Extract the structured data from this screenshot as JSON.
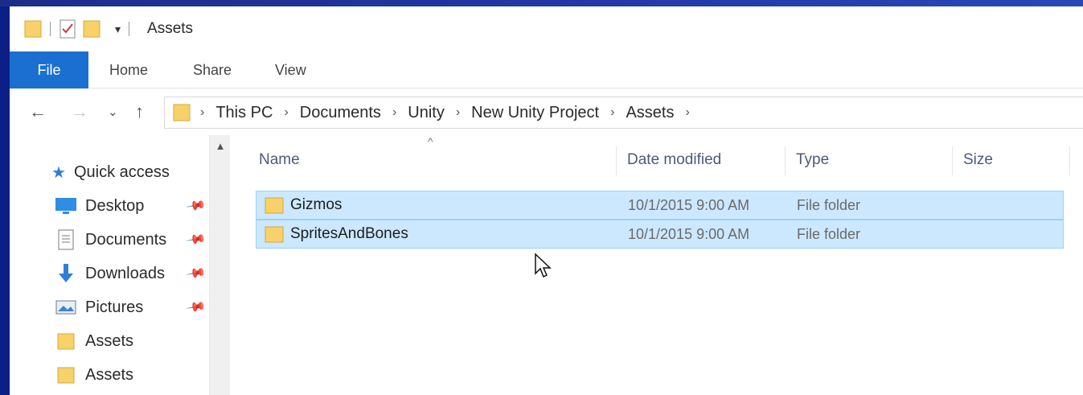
{
  "window": {
    "title": "Assets"
  },
  "ribbon": {
    "tabs": [
      "File",
      "Home",
      "Share",
      "View"
    ]
  },
  "address": {
    "crumbs": [
      "This PC",
      "Documents",
      "Unity",
      "New Unity Project",
      "Assets"
    ]
  },
  "nav_pane": {
    "items": [
      {
        "label": "Quick access",
        "icon": "star-icon"
      },
      {
        "label": "Desktop",
        "icon": "desktop-icon",
        "pinned": true
      },
      {
        "label": "Documents",
        "icon": "documents-icon",
        "pinned": true
      },
      {
        "label": "Downloads",
        "icon": "download-icon",
        "pinned": true
      },
      {
        "label": "Pictures",
        "icon": "pictures-icon",
        "pinned": true
      },
      {
        "label": "Assets",
        "icon": "folder-icon"
      },
      {
        "label": "Assets",
        "icon": "folder-icon"
      }
    ]
  },
  "file_list": {
    "columns": [
      "Name",
      "Date modified",
      "Type",
      "Size"
    ],
    "rows": [
      {
        "name": "Gizmos",
        "date": "10/1/2015 9:00 AM",
        "type": "File folder"
      },
      {
        "name": "SpritesAndBones",
        "date": "10/1/2015 9:00 AM",
        "type": "File folder"
      }
    ]
  },
  "colors": {
    "file_tab": "#1a6fd1",
    "selection": "#cce8ff",
    "selection_border": "#99d1ff",
    "folder": "#f7d26b"
  }
}
